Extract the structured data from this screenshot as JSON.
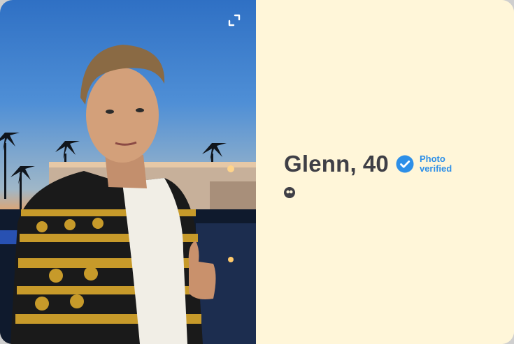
{
  "profile": {
    "name": "Glenn",
    "age": "40",
    "verification": {
      "line1": "Photo",
      "line2": "verified"
    }
  },
  "colors": {
    "panel_bg": "#fff6d9",
    "name_text": "#3f3f46",
    "verified_blue": "#2d8fe8"
  },
  "icons": {
    "expand": "expand-icon",
    "verified": "verified-badge-icon",
    "quote": "quote-icon"
  }
}
